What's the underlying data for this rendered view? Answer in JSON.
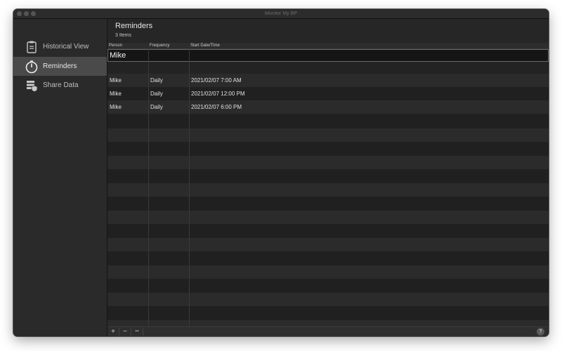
{
  "window": {
    "title": "Monitor My BP"
  },
  "sidebar": {
    "items": [
      {
        "label": "Historical View",
        "icon": "clipboard-icon",
        "selected": false
      },
      {
        "label": "Reminders",
        "icon": "timer-icon",
        "selected": true
      },
      {
        "label": "Share Data",
        "icon": "share-data-icon",
        "selected": false
      }
    ]
  },
  "header": {
    "title": "Reminders",
    "count": "3 Items"
  },
  "table": {
    "columns": [
      "Person",
      "Frequency",
      "Start Date/Time"
    ],
    "edit_value": "Mike",
    "rows": [
      {
        "person": "Mike",
        "frequency": "Daily",
        "start": "2021/02/07 7:00 AM"
      },
      {
        "person": "Mike",
        "frequency": "Daily",
        "start": "2021/02/07 12:00 PM"
      },
      {
        "person": "Mike",
        "frequency": "Daily",
        "start": "2021/02/07 6:00 PM"
      }
    ]
  },
  "footer": {
    "add_label": "+",
    "remove_label": "−",
    "more_label": "•••",
    "help_label": "?"
  }
}
